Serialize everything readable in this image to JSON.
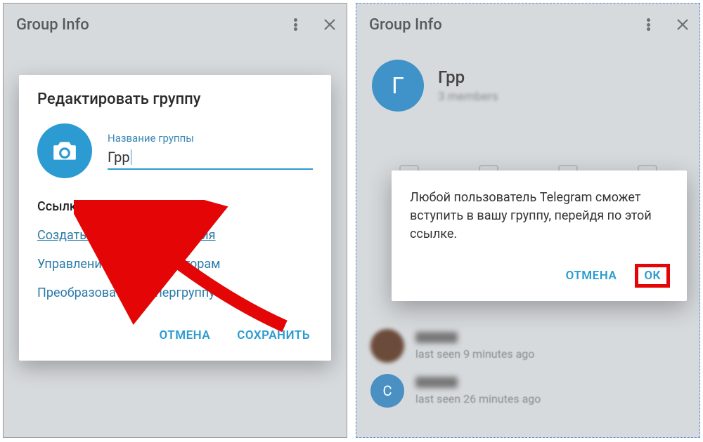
{
  "left": {
    "header": {
      "title": "Group Info"
    },
    "modal": {
      "title": "Редактировать группу",
      "name_label": "Название группы",
      "name_value": "Грр",
      "invite_section": "Ссылка для приглашения",
      "create_link": "Создать ссылку приглашения",
      "manage_admins": "Управление администраторам",
      "convert": "Преобразовать в супергруппу",
      "cancel": "ОТМЕНА",
      "save": "СОХРАНИТЬ"
    }
  },
  "right": {
    "header": {
      "title": "Group Info"
    },
    "group": {
      "name": "Грр",
      "members": "3 members",
      "initial": "Г"
    },
    "members": [
      {
        "initial": "",
        "status": "last seen 9 minutes ago"
      },
      {
        "initial": "С",
        "status": "last seen 26 minutes ago"
      }
    ],
    "dialog": {
      "body": "Любой пользователь Telegram сможет вступить в вашу группу, перейдя по этой ссылке.",
      "cancel": "ОТМЕНА",
      "ok": "ОК"
    }
  }
}
